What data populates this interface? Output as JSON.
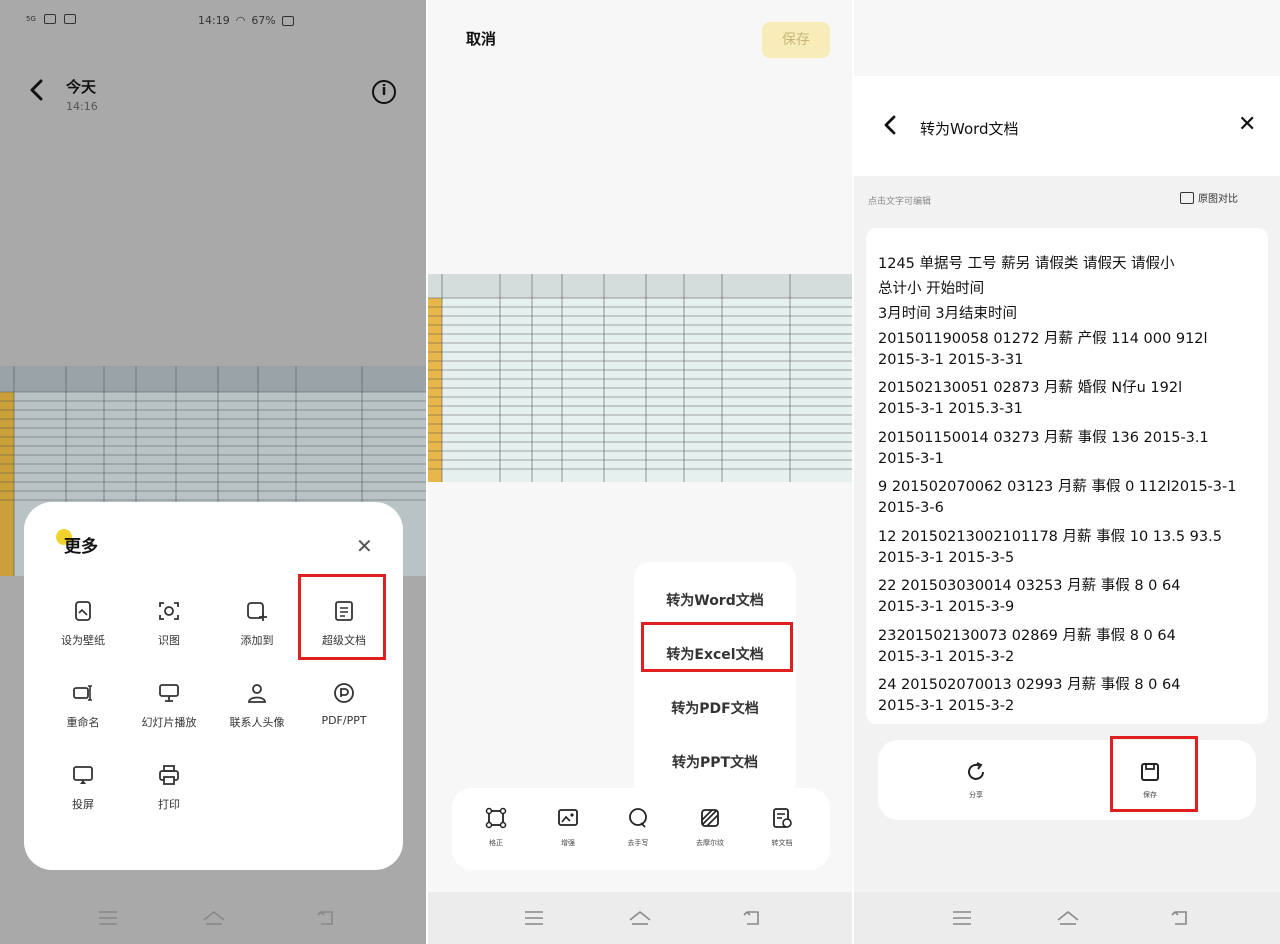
{
  "panel1": {
    "status": {
      "carrier": "5G",
      "time": "14:19",
      "battery": "67%"
    },
    "header": {
      "title": "今天",
      "subtitle": "14:16"
    },
    "more_menu": {
      "title": "更多",
      "items": [
        {
          "label": "设为壁纸",
          "icon": "wallpaper-icon"
        },
        {
          "label": "识图",
          "icon": "scan-image-icon"
        },
        {
          "label": "添加到",
          "icon": "add-to-icon"
        },
        {
          "label": "超级文档",
          "icon": "document-icon"
        },
        {
          "label": "重命名",
          "icon": "rename-icon"
        },
        {
          "label": "幻灯片播放",
          "icon": "slideshow-icon"
        },
        {
          "label": "联系人头像",
          "icon": "contact-icon"
        },
        {
          "label": "PDF/PPT",
          "icon": "pdf-icon"
        },
        {
          "label": "投屏",
          "icon": "cast-icon"
        },
        {
          "label": "打印",
          "icon": "print-icon"
        }
      ]
    }
  },
  "panel2": {
    "cancel_label": "取消",
    "save_label": "保存",
    "convert_menu": [
      "转为Word文档",
      "转为Excel文档",
      "转为PDF文档",
      "转为PPT文档"
    ],
    "toolbar": [
      "格正",
      "增强",
      "去手写",
      "去摩尔纹",
      "转文档"
    ]
  },
  "panel3": {
    "title": "转为Word文档",
    "hint": "点击文字可编辑",
    "compare_label": "原图对比",
    "ocr_lines": [
      "1245  单据号 工号 薪另 请假类 请假天 请假小",
      "总计小 开始时间",
      "3月时间 3月结束时间",
      "201501190058 01272 月薪 产假 114 000 912l",
      "2015-3-1 2015-3-31",
      "201502130051 02873 月薪 婚假 N仔u 192l",
      "2015-3-1 2015.3-31",
      "201501150014 03273 月薪 事假 136 2015-3.1",
      "2015-3-1",
      "9 201502070062 03123 月薪 事假 0 112l2015-3-1",
      "2015-3-6",
      "12 20150213002101178 月薪 事假 10 13.5 93.5",
      "2015-3-1 2015-3-5",
      "22 201503030014 03253 月薪 事假 8 0 64",
      "2015-3-1 2015-3-9",
      "23201502130073 02869 月薪 事假 8 0  64",
      "2015-3-1 2015-3-2",
      "24 201502070013 02993 月薪 事假 8 0 64",
      "2015-3-1 2015-3-2"
    ],
    "bottom_actions": [
      "分享",
      "保存"
    ]
  }
}
